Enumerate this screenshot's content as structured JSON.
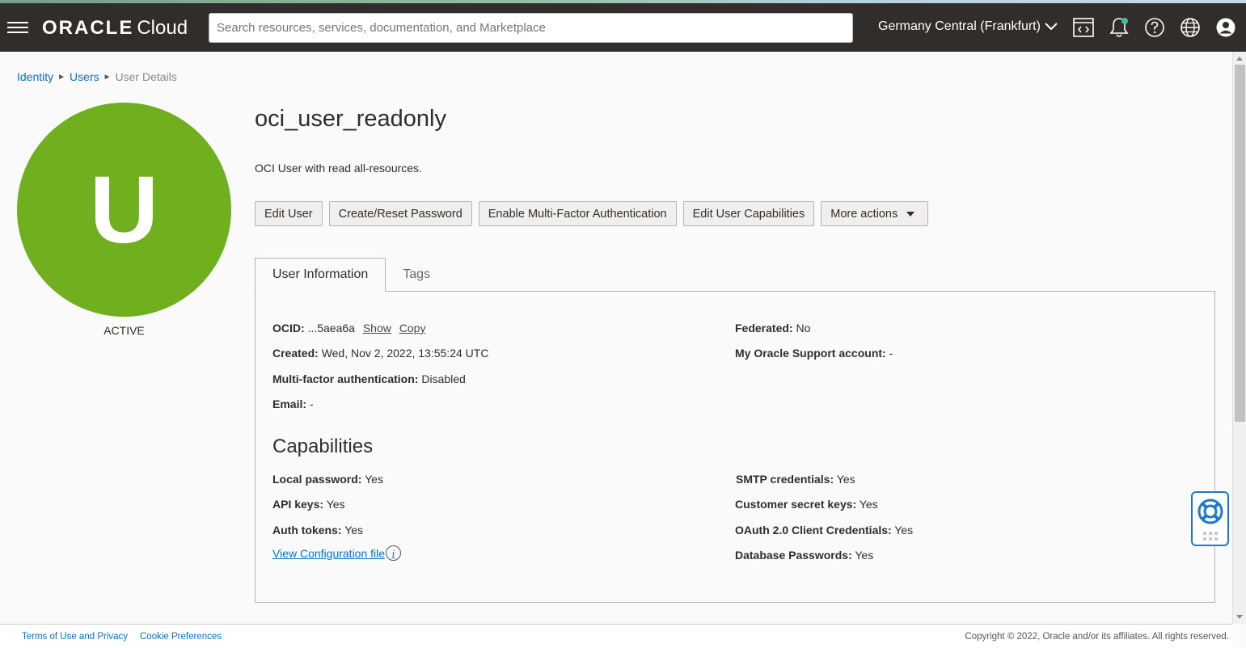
{
  "header": {
    "brand": "ORACLE",
    "product": "Cloud",
    "search_placeholder": "Search resources, services, documentation, and Marketplace",
    "region": "Germany Central (Frankfurt)",
    "icons": [
      "menu-icon",
      "cloud-shell-icon",
      "bell-icon",
      "help-icon",
      "globe-icon",
      "profile-icon"
    ],
    "notification_dot_color": "#3fbf9f"
  },
  "breadcrumb": {
    "items": [
      "Identity",
      "Users"
    ],
    "current": "User Details"
  },
  "user": {
    "avatar_letter": "U",
    "avatar_color": "#70b01e",
    "status": "ACTIVE",
    "name": "oci_user_readonly",
    "description": "OCI User with read all-resources."
  },
  "actions": {
    "edit_user": "Edit User",
    "reset_password": "Create/Reset Password",
    "enable_mfa": "Enable Multi-Factor Authentication",
    "edit_capabilities": "Edit User Capabilities",
    "more_actions": "More actions"
  },
  "tabs": {
    "user_information": "User Information",
    "tags": "Tags"
  },
  "info": {
    "ocid_label": "OCID:",
    "ocid_value": "...5aea6a",
    "show": "Show",
    "copy": "Copy",
    "created_label": "Created:",
    "created_value": "Wed, Nov 2, 2022, 13:55:24 UTC",
    "mfa_label": "Multi-factor authentication:",
    "mfa_value": "Disabled",
    "email_label": "Email:",
    "email_value": "-",
    "federated_label": "Federated:",
    "federated_value": "No",
    "support_label": "My Oracle Support account:",
    "support_value": "-"
  },
  "capabilities": {
    "title": "Capabilities",
    "local_password_label": "Local password:",
    "local_password_value": "Yes",
    "api_keys_label": "API keys:",
    "api_keys_value": "Yes",
    "auth_tokens_label": "Auth tokens:",
    "auth_tokens_value": "Yes",
    "smtp_label": "SMTP credentials:",
    "smtp_value": "Yes",
    "secret_keys_label": "Customer secret keys:",
    "secret_keys_value": "Yes",
    "oauth_label": "OAuth 2.0 Client Credentials:",
    "oauth_value": "Yes",
    "db_passwords_label": "Database Passwords:",
    "db_passwords_value": "Yes",
    "view_config": "View Configuration file"
  },
  "footer": {
    "terms": "Terms of Use and Privacy",
    "cookies": "Cookie Preferences",
    "copyright": "Copyright © 2022, Oracle and/or its affiliates. All rights reserved."
  }
}
